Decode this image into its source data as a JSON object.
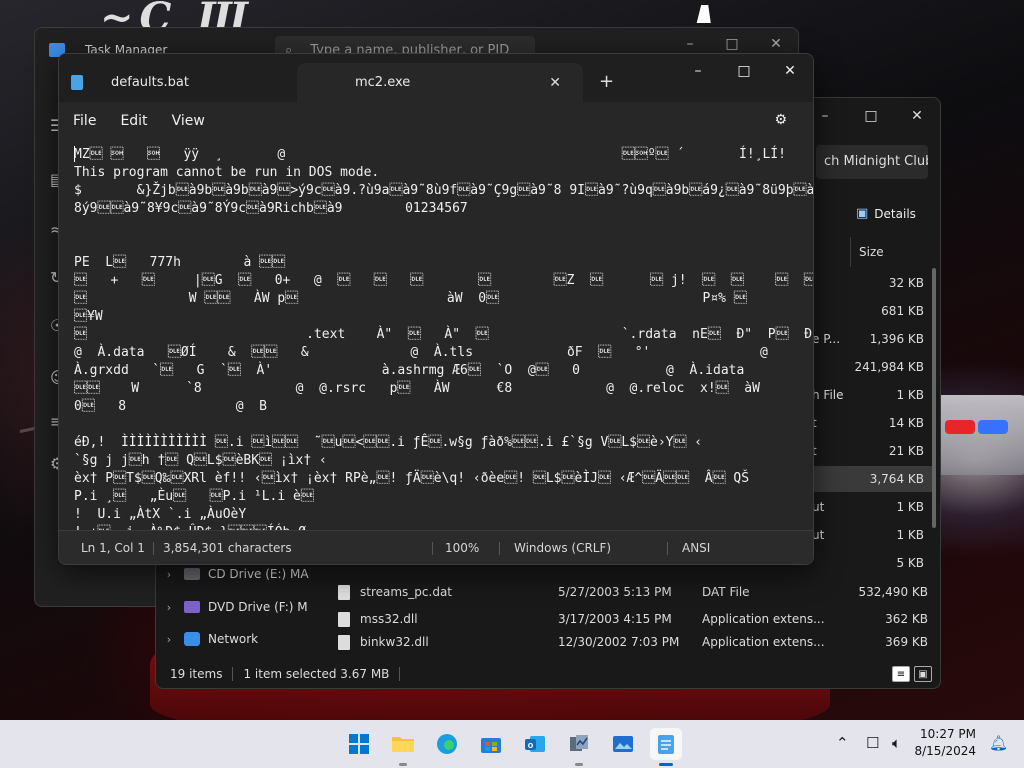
{
  "task_manager": {
    "title": "Task Manager",
    "search_placeholder": "Type a name, publisher, or PID"
  },
  "explorer": {
    "address_text": "ch Midnight Club II",
    "details_label": "Details",
    "size_header": "Size",
    "partial_rows": [
      {
        "type": "",
        "size": "32 KB"
      },
      {
        "type": "",
        "size": "681 KB"
      },
      {
        "type": "e P...",
        "size": "1,396 KB"
      },
      {
        "type": "",
        "size": "241,984 KB"
      },
      {
        "type": "h File",
        "size": "1 KB"
      },
      {
        "type": "t",
        "size": "14 KB"
      },
      {
        "type": "t",
        "size": "21 KB"
      },
      {
        "type": "",
        "size": "3,764 KB"
      },
      {
        "type": "ut",
        "size": "1 KB"
      },
      {
        "type": "ut",
        "size": "1 KB"
      },
      {
        "type": "",
        "size": "5 KB"
      }
    ],
    "nav_items": [
      {
        "label": "CD Drive (E:) MA",
        "icon": "cd-drive-icon"
      },
      {
        "label": "DVD Drive (F:) M",
        "icon": "dvd-drive-icon"
      },
      {
        "label": "Network",
        "icon": "network-icon"
      }
    ],
    "files": [
      {
        "name": "streams_pc.dat",
        "date": "5/27/2003 5:13 PM",
        "type": "DAT File",
        "size": "532,490 KB"
      },
      {
        "name": "mss32.dll",
        "date": "3/17/2003 4:15 PM",
        "type": "Application extens...",
        "size": "362 KB"
      },
      {
        "name": "binkw32.dll",
        "date": "12/30/2002 7:03 PM",
        "type": "Application extens...",
        "size": "369 KB"
      }
    ],
    "status_items": "19 items",
    "status_selected": "1 item selected  3.67 MB"
  },
  "notepad": {
    "tab_inactive": "defaults.bat",
    "tab_active": "mc2.exe",
    "menu": [
      "File",
      "Edit",
      "View"
    ],
    "content": "MZ\u0010 \u0001   \u0001   ÿÿ  ¸       @                                           \u0010\u0001º\u0010 ´       Í!¸LÍ!\nThis program cannot be run in DOS mode.\n$       &}Žjb\u0010à9b\u0010à9b\u0010à9\u0010>ý9c\u0010à9.?ù9a\u0010à9˜8ù9f\u0010à9˜Ç9g\u0010à9˜8 9I\u0010à9˜?ù9q\u0010à9b\u0010á9¿\u0010à9˜8ü9þ\u0010à9˜\n8ý9\u0010\u0010à9˜8¥9c\u0010à9˜8Ý9c\u0010à9Richb\u0010à9        01234567\n\n\nPE  L\u0010   777h        à \u0010\u0010\n\u0010   +   \u0010     |\u0010G  \u0010   0+   @  \u0010   \u0010   \u0010       \u0010        \u0010Z  \u0010      \u0010 j!  \u0010  \u0010    \u0010  \u0010\n\u0010             W \u0010\u0010   ÀW p\u0010                   àW  0\u0010                          P¤% \u0010\n\u0010¥W\n\u0010                            .text    À\"  \u0010   À\"  \u0010                 `.rdata  nE\u0010  Ð\"  P\u0010  Ð\"\n@  À.data   \u0010ØÍ    &  \u0010\u0010   &             @  À.tls            ðF  \u0010   °'              @\nÀ.grxdd   `\u0010   G  `\u0010  À'              à.ashrmg Æ6\u0010  `O  @\u0010   0           @  À.idata\n\u0010\u0010    W      `8            @  @.rsrc   p\u0010   ÀW      €8            @  @.reloc  x!\u0010  àW\n0\u0010   8              @  B\n\néÐ,!  ÌÌÌÌÌÌÌÌÌÌÌ \u0010.i \u0010ì\u0010\u0010  ˜\u0010u\u0010<\u0010\u0010.i ƒÊ\u0010.w§g ƒàð%\u0010\u0010.i £`§g V\u0010L$\u0010è›Y\u0010 ‹\n`§g j j\u0010h †\u0010 Q\u0010L$\u0010èBK\u0010 ¡ìx† ‹\nèx† P\u0010T$\u0010Q‰\u0010XRl èf!! ‹\u0010ìx† ¡èx† RPè„\u0010! ƒÄ\u0010è\\q! ‹ðèe\u0010! \u0010L$\u0010èÌJ\u0010 ‹Æ^\u0010Ä\u0010\u0010  Â\u0010 QŠ\nP.i ¸\u0010   „Èu\u0010   \u0010P.i ¹L.i è\u0010\n!  U.i „ÀtX `.i „ÀuOèY\n!.+\u0010  i  À%D$ ÛD$ }\u0010\u0010\u0010ÍÓb Ø",
    "status": {
      "position": "Ln 1, Col 1",
      "characters": "3,854,301 characters",
      "zoom": "100%",
      "line_ending": "Windows (CRLF)",
      "encoding": "ANSI"
    }
  },
  "taskbar": {
    "time": "10:27 PM",
    "date": "8/15/2024"
  }
}
